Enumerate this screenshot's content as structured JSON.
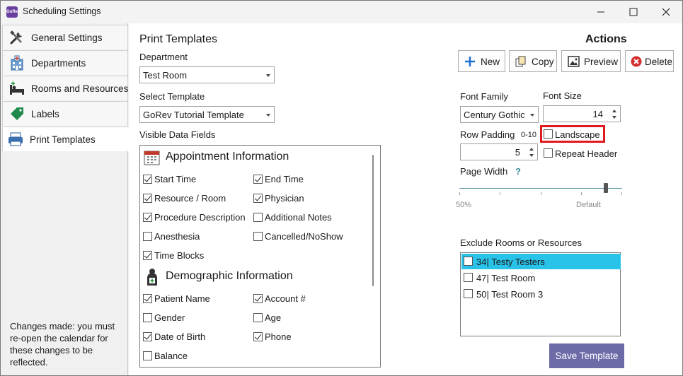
{
  "window": {
    "title": "Scheduling Settings",
    "app_icon_text": "GoRev"
  },
  "sidebar": {
    "items": [
      {
        "label": "General Settings",
        "icon": "tools-icon"
      },
      {
        "label": "Departments",
        "icon": "hospital-icon"
      },
      {
        "label": "Rooms and Resources",
        "icon": "bed-icon"
      },
      {
        "label": "Labels",
        "icon": "tag-icon"
      },
      {
        "label": "Print Templates",
        "icon": "printer-icon",
        "active": true
      }
    ],
    "changes_note": "Changes made: you must re-open the calendar for these changes to be reflected."
  },
  "print_templates": {
    "heading": "Print Templates",
    "department_label": "Department",
    "department_value": "Test Room",
    "select_template_label": "Select Template",
    "template_value": "GoRev Tutorial Template",
    "visible_fields_label": "Visible Data Fields",
    "sections": [
      {
        "title": "Appointment Information",
        "icon": "calendar-icon",
        "fields": [
          {
            "label": "Start Time",
            "checked": true
          },
          {
            "label": "End Time",
            "checked": true
          },
          {
            "label": "Resource / Room",
            "checked": true
          },
          {
            "label": "Physician",
            "checked": true
          },
          {
            "label": "Procedure Description",
            "checked": true
          },
          {
            "label": "Additional Notes",
            "checked": false
          },
          {
            "label": "Anesthesia",
            "checked": false
          },
          {
            "label": "Cancelled/NoShow",
            "checked": false
          },
          {
            "label": "Time Blocks",
            "checked": true
          }
        ]
      },
      {
        "title": "Demographic Information",
        "icon": "patient-icon",
        "fields": [
          {
            "label": "Patient Name",
            "checked": true
          },
          {
            "label": "Account #",
            "checked": true
          },
          {
            "label": "Gender",
            "checked": false
          },
          {
            "label": "Age",
            "checked": false
          },
          {
            "label": "Date of Birth",
            "checked": true
          },
          {
            "label": "Phone",
            "checked": true
          },
          {
            "label": "Balance",
            "checked": false
          }
        ]
      }
    ]
  },
  "actions": {
    "heading": "Actions",
    "new_label": "New",
    "copy_label": "Copy",
    "preview_label": "Preview",
    "delete_label": "Delete",
    "font_family_label": "Font Family",
    "font_family_value": "Century Gothic",
    "font_size_label": "Font Size",
    "font_size_value": "14",
    "row_padding_label": "Row Padding",
    "row_padding_range": "0-10",
    "row_padding_value": "5",
    "landscape_label": "Landscape",
    "landscape_checked": false,
    "repeat_header_label": "Repeat Header",
    "repeat_header_checked": false,
    "page_width_label": "Page Width",
    "page_width_help": "?",
    "page_width_min_label": "50%",
    "page_width_default_label": "Default",
    "page_width_level": 0.9,
    "exclude_label": "Exclude Rooms or Resources",
    "exclude_items": [
      {
        "label": "34| Testy Testers",
        "checked": false,
        "selected": true
      },
      {
        "label": "47| Test Room",
        "checked": false,
        "selected": false
      },
      {
        "label": "50| Test Room 3",
        "checked": false,
        "selected": false
      }
    ],
    "save_label": "Save Template"
  },
  "colors": {
    "accent_selected": "#29c2e8",
    "save_button": "#6d6aa8",
    "highlight_box": "#e0191f",
    "delete_icon": "#d32f2f",
    "new_icon": "#1e6fd0"
  }
}
